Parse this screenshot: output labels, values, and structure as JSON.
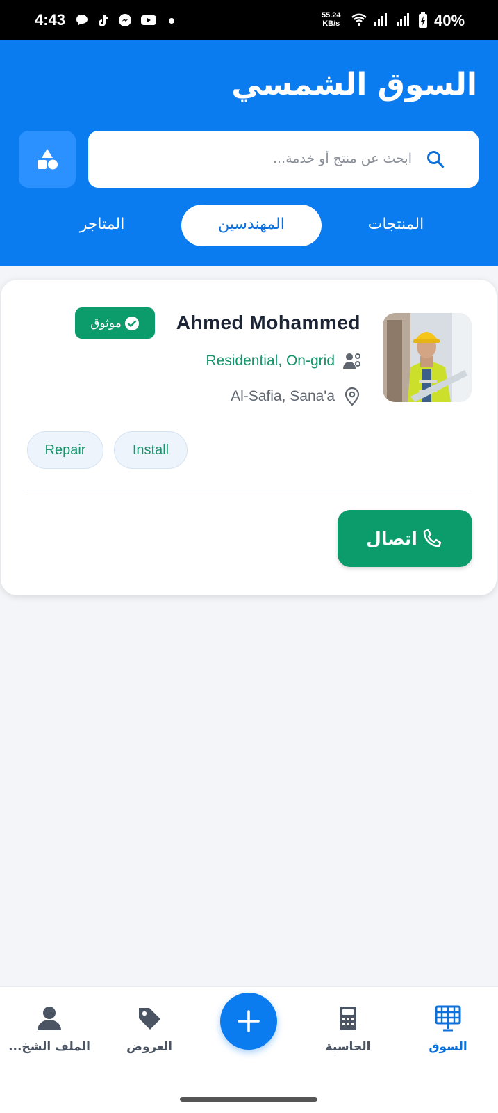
{
  "status_bar": {
    "time": "4:43",
    "net_speed_value": "55.24",
    "net_speed_unit": "KB/s",
    "battery": "40%",
    "notification_icons": [
      "chat-icon",
      "tiktok-icon",
      "messenger-icon",
      "youtube-icon"
    ]
  },
  "header": {
    "title": "السوق الشمسي",
    "search_placeholder": "ابحث عن منتج أو خدمة...",
    "tabs": [
      {
        "label": "المنتجات",
        "active": false
      },
      {
        "label": "المهندسين",
        "active": true
      },
      {
        "label": "المتاجر",
        "active": false
      }
    ],
    "accent_color": "#0b7bf0"
  },
  "engineer_card": {
    "name": "Ahmed Mohammed",
    "verified_label": "موثوق",
    "specialty": "Residential, On-grid",
    "location": "Al-Safia, Sana'a",
    "services": [
      "Install",
      "Repair"
    ],
    "call_label": "اتصال",
    "accent_color": "#0c9b6b"
  },
  "bottom_nav": {
    "items": [
      {
        "label": "السوق",
        "icon": "solar-panel-icon",
        "active": true
      },
      {
        "label": "الحاسبة",
        "icon": "calculator-icon",
        "active": false
      },
      {
        "label": "العروض",
        "icon": "tag-icon",
        "active": false
      },
      {
        "label": "الملف الشخ...",
        "icon": "person-icon",
        "active": false
      }
    ],
    "fab_icon": "plus-icon"
  }
}
